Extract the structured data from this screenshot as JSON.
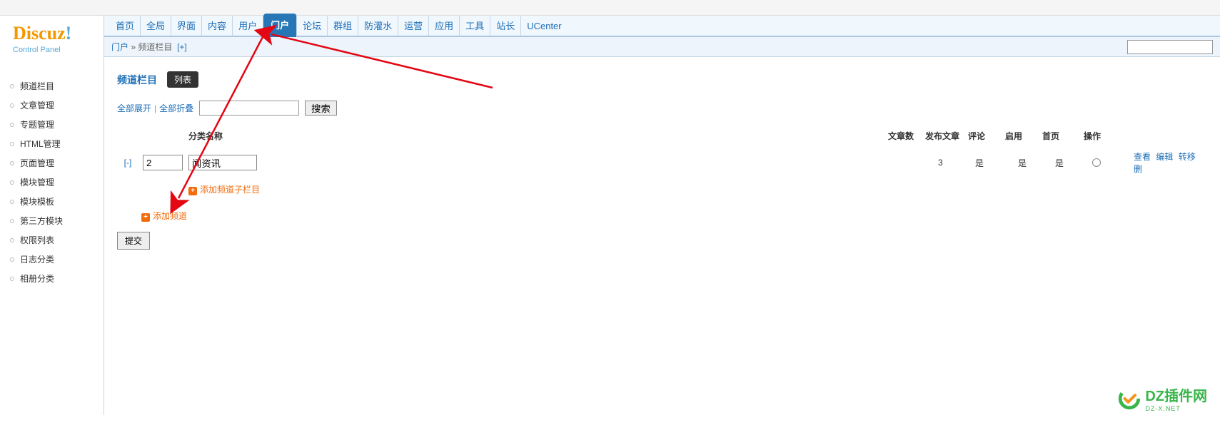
{
  "logo": {
    "main": "Discuz",
    "excl": "!",
    "sub": "Control Panel"
  },
  "nav": {
    "items": [
      "首页",
      "全局",
      "界面",
      "内容",
      "用户",
      "门户",
      "论坛",
      "群组",
      "防灌水",
      "运营",
      "应用",
      "工具",
      "站长",
      "UCenter"
    ],
    "active_index": 5
  },
  "breadcrumb": {
    "root": "门户",
    "sep": "»",
    "current": "频道栏目",
    "plus": "[+]"
  },
  "sidebar": {
    "items": [
      "频道栏目",
      "文章管理",
      "专题管理",
      "HTML管理",
      "页面管理",
      "模块管理",
      "模块模板",
      "第三方模块",
      "权限列表",
      "日志分类",
      "相册分类"
    ]
  },
  "page": {
    "title": "频道栏目",
    "list_button": "列表",
    "expand_all": "全部展开",
    "collapse_all": "全部折叠",
    "search_button": "搜索",
    "submit_button": "提交"
  },
  "table": {
    "headers": {
      "name": "分类名称",
      "articles": "文章数",
      "publish": "发布文章",
      "comment": "评论",
      "enable": "启用",
      "home": "首页",
      "operate": "操作"
    },
    "row": {
      "toggle": "[-]",
      "order": "2",
      "name": "闻资讯",
      "articles": "3",
      "publish": "是",
      "comment": "是",
      "enable": "是",
      "ops": {
        "view": "查看",
        "edit": "编辑",
        "move": "转移",
        "del": "删"
      }
    },
    "add_sub": "添加频道子栏目",
    "add_channel": "添加频道"
  },
  "watermark": {
    "brand": "DZ插件网",
    "sub": "DZ-X.NET"
  }
}
